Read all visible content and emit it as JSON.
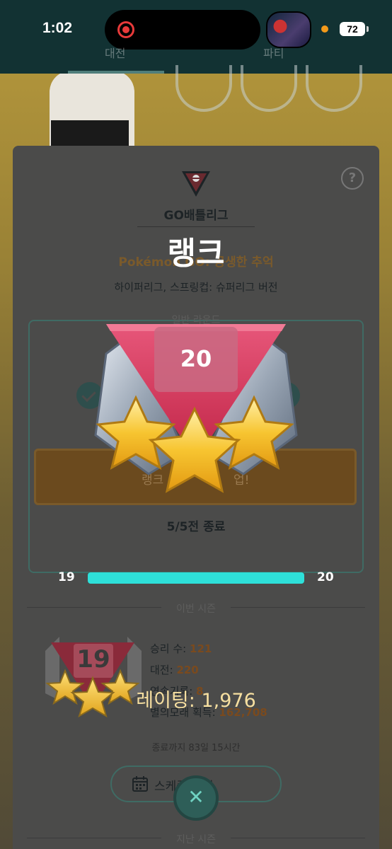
{
  "status_bar": {
    "time": "1:02",
    "battery": "72"
  },
  "tabs": {
    "battle": "대전",
    "party": "파티"
  },
  "league": {
    "title": "GO배틀리그",
    "season_name": "Pokémon GO: 공생한 추억",
    "season_sub": "하이퍼리그, 스프링컵: 슈퍼리그 버전",
    "round_label": "일반 라운드",
    "rank_up_label": "랭크",
    "rank_up_suffix": "업!",
    "battles_done": "5/5전 종료"
  },
  "rank_overlay": {
    "heading": "랭크",
    "rank_number": "20",
    "from_rank": "19",
    "to_rank": "20",
    "progress_fraction": 1.0,
    "rating_label": "레이팅: 1,976"
  },
  "current_season": {
    "label": "이번 시즌",
    "small_rank": "19",
    "stats": [
      {
        "label": "승리 수:",
        "value": "121"
      },
      {
        "label": "대전:",
        "value": "220"
      },
      {
        "label": "연속기록:",
        "value": "8"
      },
      {
        "label": "별의모래 획득:",
        "value": "162,708"
      }
    ],
    "remaining": "종료까지 83일 15시간",
    "schedule_label": "스케줄 보기"
  },
  "past_season_label": "지난 시즌",
  "colors": {
    "accent": "#2ee0d9",
    "rank_red": "#d43b5a",
    "star_gold": "#f7c531"
  }
}
